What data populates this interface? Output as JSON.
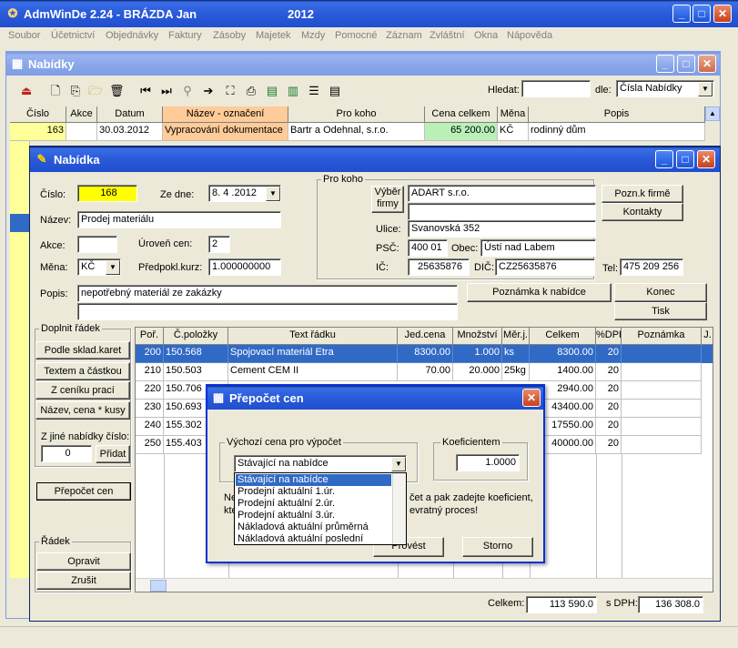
{
  "app": {
    "title": "AdmWinDe 2.24 - BRÁZDA Jan",
    "year": "2012"
  },
  "menu": [
    "Soubor",
    "Účetnictví",
    "Objednávky",
    "Faktury",
    "Zásoby",
    "Majetek",
    "Mzdy",
    "Pomocné",
    "Záznam",
    "Zvláštní",
    "Okna",
    "Nápověda"
  ],
  "nabidky": {
    "title": "Nabídky",
    "search_label": "Hledat:",
    "search_value": "",
    "by_label": "dle:",
    "by_value": "Čísla Nabídky",
    "columns": [
      "Číslo",
      "Akce",
      "Datum",
      "Název - označení",
      "Pro koho",
      "Cena celkem",
      "Měna",
      "Popis"
    ],
    "row": {
      "cislo": "163",
      "akce": "",
      "datum": "30.03.2012",
      "nazev": "Vypracování dokumentace",
      "pro_koho": "Bartr a Odehnal, s.r.o.",
      "cena": "65 200.00",
      "mena": "KČ",
      "popis": "rodinný dům"
    }
  },
  "nabidka": {
    "title": "Nabídka",
    "cislo_label": "Číslo:",
    "cislo": "168",
    "ze_dne_label": "Ze dne:",
    "ze_dne": "8. 4 .2012",
    "nazev_label": "Název:",
    "nazev": "Prodej materiálu",
    "akce_label": "Akce:",
    "akce": "",
    "uroven_label": "Úroveň cen:",
    "uroven": "2",
    "mena_label": "Měna:",
    "mena": "KČ",
    "kurz_label": "Předpokl.kurz:",
    "kurz": "1.000000000",
    "popis_label": "Popis:",
    "popis": "nepotřebný materiál ze zakázky",
    "popis2": "",
    "pro_koho": {
      "group": "Pro koho",
      "vyber_firmy": "Výběr firmy",
      "firma": "ADART s.r.o.",
      "firma2": "",
      "ulice_label": "Ulice:",
      "ulice": "Svanovská 352",
      "psc_label": "PSČ:",
      "psc": "400 01",
      "obec_label": "Obec:",
      "obec": "Ústí nad Labem",
      "ic_label": "IČ:",
      "ic": "25635876",
      "dic_label": "DIČ:",
      "dic": "CZ25635876",
      "tel_label": "Tel:",
      "tel": "475 209 256"
    },
    "buttons": {
      "pozn_firme": "Pozn.k firmě",
      "kontakty": "Kontakty",
      "poznamka": "Poznámka k nabídce",
      "konec": "Konec",
      "tisk": "Tisk"
    },
    "doplnit": {
      "group": "Doplnit řádek",
      "b1": "Podle sklad.karet",
      "b2": "Textem a částkou",
      "b3": "Z ceníku prací",
      "b4": "Název, cena * kusy",
      "jine_label": "Z jiné nabídky číslo:",
      "jine_value": "0",
      "pridat": "Přidat"
    },
    "prepocet_button": "Přepočet cen",
    "radek": {
      "group": "Řádek",
      "opravit": "Opravit",
      "zrusit": "Zrušit"
    },
    "columns": [
      "Poř.",
      "Č.položky",
      "Text řádku",
      "Jed.cena",
      "Množství",
      "Měr.j.",
      "Celkem",
      "%DPH",
      "Poznámka",
      "J."
    ],
    "rows": [
      {
        "por": "200",
        "pol": "150.568",
        "text": "Spojovací materiál Etra",
        "cena": "8300.00",
        "mnoz": "1.000",
        "mj": "ks",
        "celkem": "8300.00",
        "dph": "20",
        "pozn": ""
      },
      {
        "por": "210",
        "pol": "150.503",
        "text": "Cement CEM II",
        "cena": "70.00",
        "mnoz": "20.000",
        "mj": "25kg",
        "celkem": "1400.00",
        "dph": "20",
        "pozn": ""
      },
      {
        "por": "220",
        "pol": "150.706",
        "text": "",
        "cena": "",
        "mnoz": "",
        "mj": "",
        "celkem": "2940.00",
        "dph": "20",
        "pozn": ""
      },
      {
        "por": "230",
        "pol": "150.693",
        "text": "",
        "cena": "",
        "mnoz": "",
        "mj": "",
        "celkem": "43400.00",
        "dph": "20",
        "pozn": ""
      },
      {
        "por": "240",
        "pol": "155.302",
        "text": "",
        "cena": "",
        "mnoz": "",
        "mj": "",
        "celkem": "17550.00",
        "dph": "20",
        "pozn": ""
      },
      {
        "por": "250",
        "pol": "155.403",
        "text": "",
        "cena": "",
        "mnoz": "",
        "mj": "",
        "celkem": "40000.00",
        "dph": "20",
        "pozn": ""
      }
    ],
    "celkem_label": "Celkem:",
    "celkem": "113 590.0",
    "s_dph_label": "s DPH:",
    "s_dph": "136 308.0"
  },
  "dialog": {
    "title": "Přepočet cen",
    "vychozi_group": "Výchozí cena pro výpočet",
    "selected": "Stávající na nabídce",
    "options": [
      "Stávající na nabídce",
      "Prodejní aktuální 1.úr.",
      "Prodejní aktuální 2.úr.",
      "Prodejní aktuální 3.úr.",
      "Nákladová aktuální průměrná",
      "Nákladová aktuální poslední"
    ],
    "koef_group": "Koeficientem",
    "koef": "1.0000",
    "info_left1": "Ne",
    "info_left2": "kte",
    "info_right1": "čet a pak zadejte koeficient,",
    "info_right2": "evratný proces!",
    "provest": "Provést",
    "storno": "Storno"
  },
  "colors": {
    "highlight_yellow": "#ffff00",
    "selected_row": "#316ac5",
    "name_cell": "#ffcc99",
    "price_cell": "#b8f0b8"
  }
}
